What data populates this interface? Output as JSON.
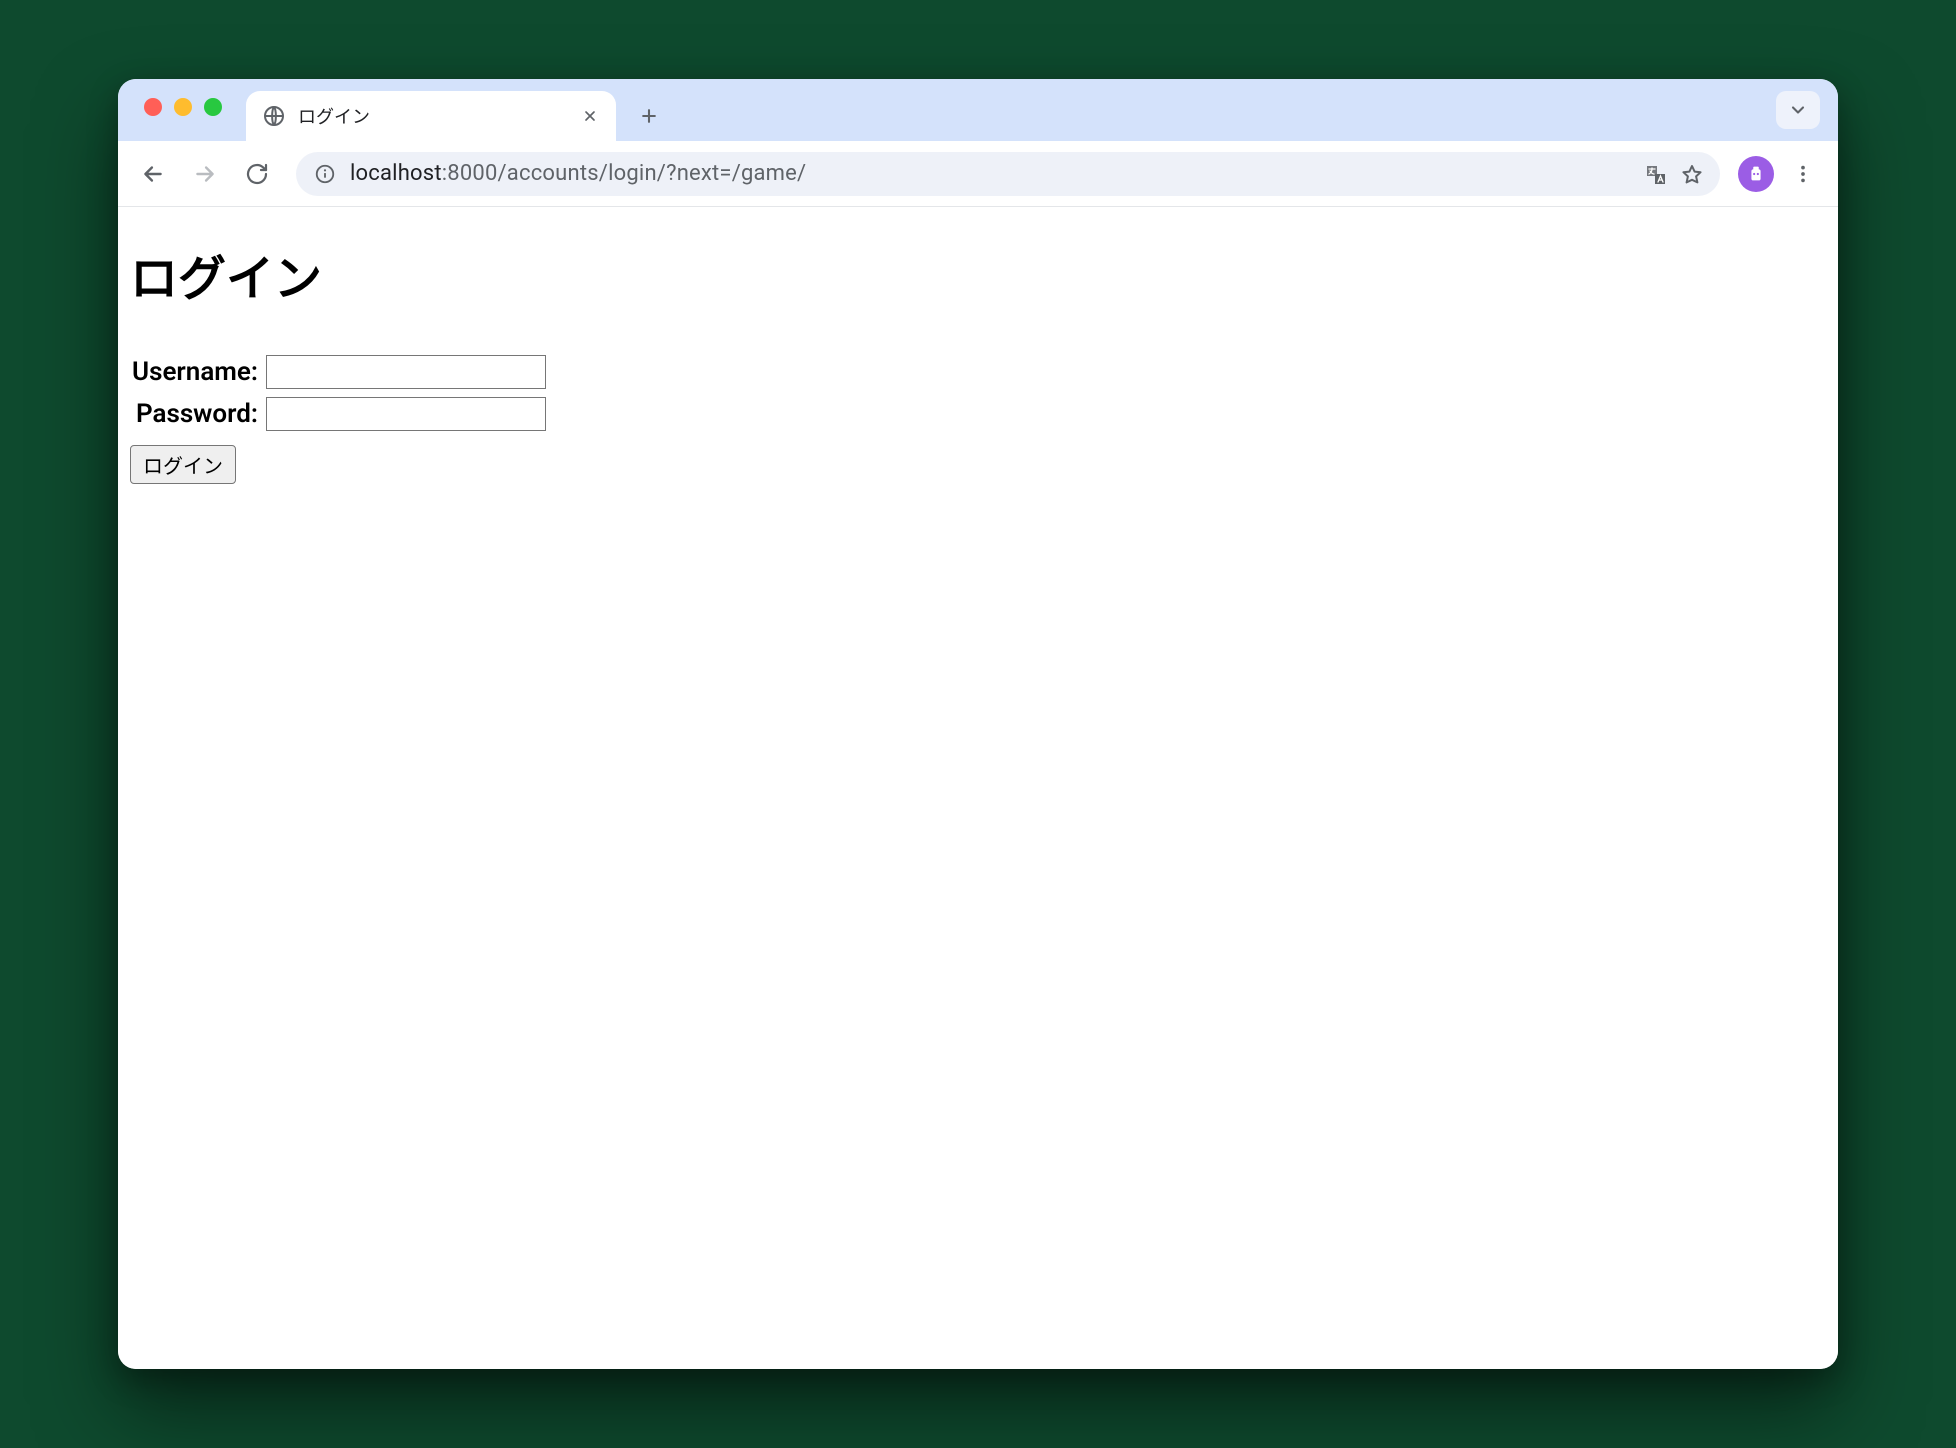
{
  "browser": {
    "tab_title": "ログイン",
    "url_host": "localhost",
    "url_port_path": ":8000/accounts/login/?next=/game/"
  },
  "page": {
    "heading": "ログイン",
    "form": {
      "username_label": "Username:",
      "username_value": "",
      "password_label": "Password:",
      "password_value": "",
      "submit_label": "ログイン"
    }
  }
}
